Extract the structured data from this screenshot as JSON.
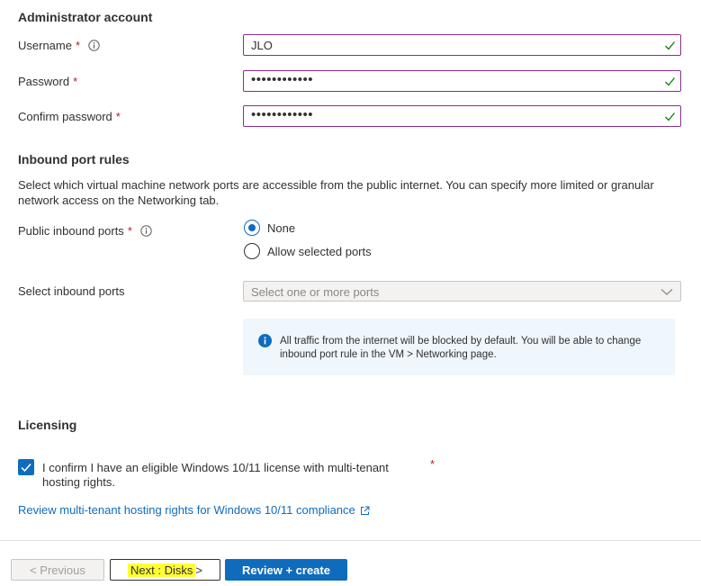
{
  "admin": {
    "title": "Administrator account",
    "username_label": "Username",
    "username_value": "JLO",
    "password_label": "Password",
    "password_value": "••••••••••••",
    "confirm_label": "Confirm password",
    "confirm_value": "••••••••••••",
    "required_mark": "*"
  },
  "inbound": {
    "title": "Inbound port rules",
    "description": "Select which virtual machine network ports are accessible from the public internet. You can specify more limited or granular network access on the Networking tab.",
    "public_ports_label": "Public inbound ports",
    "options": [
      {
        "label": "None",
        "selected": true
      },
      {
        "label": "Allow selected ports",
        "selected": false
      }
    ],
    "select_label": "Select inbound ports",
    "select_placeholder": "Select one or more ports",
    "info_text": "All traffic from the internet will be blocked by default. You will be able to change inbound port rule in the VM > Networking page."
  },
  "licensing": {
    "title": "Licensing",
    "confirm_text": "I confirm I have an eligible Windows 10/11 license with multi-tenant hosting rights.",
    "checked": true,
    "required_mark": "*",
    "link_text": "Review multi-tenant hosting rights for Windows 10/11 compliance"
  },
  "footer": {
    "previous_label": "< Previous",
    "next_label": "Next : Disks",
    "next_suffix": " >",
    "review_label": "Review + create"
  },
  "colors": {
    "accent": "#0f6cbd",
    "valid_border": "#8a2d8f",
    "valid_check": "#107c10",
    "required": "#a4262c",
    "highlight": "#ffff33"
  }
}
